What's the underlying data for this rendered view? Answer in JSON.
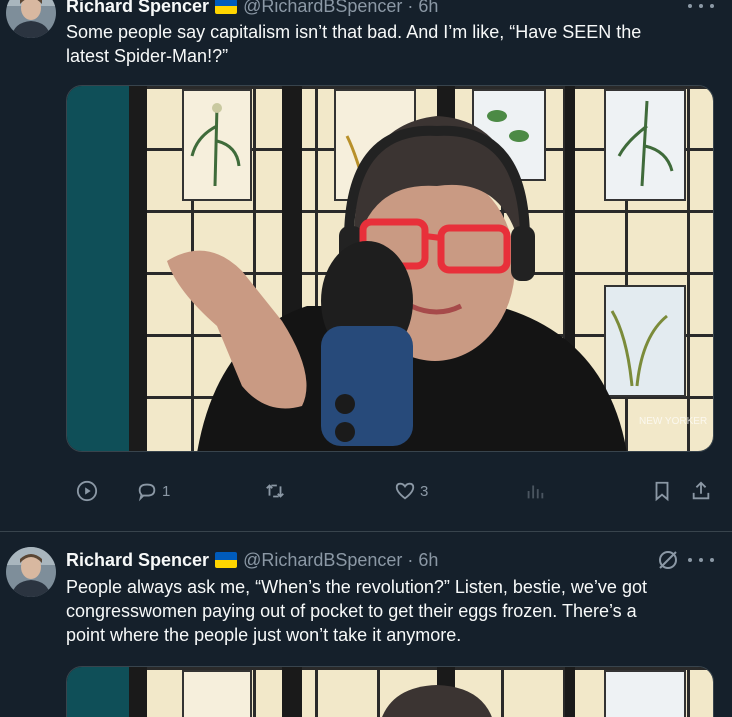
{
  "tweets": [
    {
      "author": {
        "name": "Richard Spencer",
        "handle": "@RichardBSpencer",
        "separator": "·",
        "time": "6h"
      },
      "text_line1": "Some people say capitalism isn’t that bad. And I’m like, “Have SEEN the",
      "text_line2": "latest Spider-Man!?”",
      "media_watermark": "NEW YORKER",
      "actions": {
        "replies": "1",
        "reposts": "",
        "likes": "3",
        "views": ""
      }
    },
    {
      "author": {
        "name": "Richard Spencer",
        "handle": "@RichardBSpencer",
        "separator": "·",
        "time": "6h"
      },
      "text_line1": "People always ask me, “When’s the revolution?” Listen, bestie, we’ve got",
      "text_line2": "congresswomen paying out of pocket to get their eggs frozen. There’s a",
      "text_line3": "point where the people just won’t take it anymore."
    }
  ],
  "colors": {
    "background": "#15202b",
    "secondary_text": "#8b98a5",
    "divider": "#38444d",
    "flag_blue": "#005bbb",
    "flag_yellow": "#ffd500",
    "glasses_red": "#e8303a"
  },
  "icons": [
    "play-icon",
    "reply-icon",
    "repost-icon",
    "like-icon",
    "views-icon",
    "bookmark-icon",
    "share-icon",
    "more-icon",
    "grok-icon",
    "verified-flag-icon"
  ]
}
